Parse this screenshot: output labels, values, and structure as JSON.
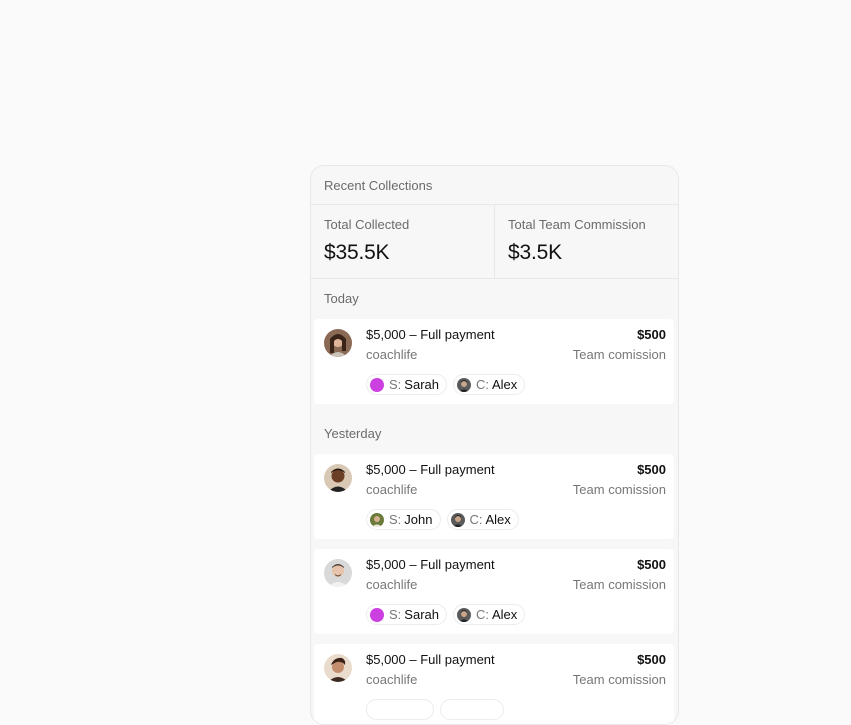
{
  "panel": {
    "title": "Recent Collections"
  },
  "stats": {
    "total_collected_label": "Total Collected",
    "total_collected_value": "$35.5K",
    "team_commission_label": "Total Team Commission",
    "team_commission_value": "$3.5K"
  },
  "groups": [
    {
      "label": "Today",
      "items": [
        {
          "title": "$5,000 – Full payment",
          "subtitle": "coachlife",
          "amount": "$500",
          "amount_label": "Team comission",
          "avatar": "woman-dark-hair",
          "setter_prefix": "S:",
          "setter": "Sarah",
          "setter_color": "#cc3fe0",
          "closer_prefix": "C:",
          "closer": "Alex"
        }
      ]
    },
    {
      "label": "Yesterday",
      "items": [
        {
          "title": "$5,000 – Full payment",
          "subtitle": "coachlife",
          "amount": "$500",
          "amount_label": "Team comission",
          "avatar": "man-dark-skin",
          "setter_prefix": "S:",
          "setter": "John",
          "setter_color": "#6a7a3a",
          "closer_prefix": "C:",
          "closer": "Alex"
        },
        {
          "title": "$5,000 – Full payment",
          "subtitle": "coachlife",
          "amount": "$500",
          "amount_label": "Team comission",
          "avatar": "man-light-gray",
          "setter_prefix": "S:",
          "setter": "Sarah",
          "setter_color": "#cc3fe0",
          "closer_prefix": "C:",
          "closer": "Alex"
        },
        {
          "title": "$5,000 – Full payment",
          "subtitle": "coachlife",
          "amount": "$500",
          "amount_label": "Team comission",
          "avatar": "man-brown-hair"
        }
      ]
    }
  ]
}
